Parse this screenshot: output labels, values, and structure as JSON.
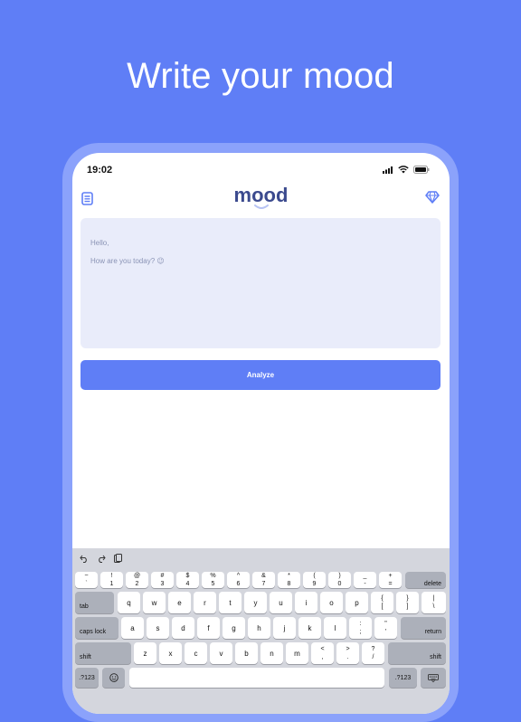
{
  "headline": "Write your mood",
  "status": {
    "time": "19:02"
  },
  "app": {
    "logo": "mood"
  },
  "editor": {
    "placeholder_line1": "Hello,",
    "placeholder_line2": "How are you today? 😉"
  },
  "actions": {
    "analyze_label": "Analyze"
  },
  "colors": {
    "background": "#5f7ef6",
    "accent": "#5f7ef6",
    "logo": "#3b4a8e",
    "editor_bg": "#e9ecfa"
  },
  "keyboard": {
    "row1": [
      {
        "top": "~",
        "bottom": "`"
      },
      {
        "top": "!",
        "bottom": "1"
      },
      {
        "top": "@",
        "bottom": "2"
      },
      {
        "top": "#",
        "bottom": "3"
      },
      {
        "top": "$",
        "bottom": "4"
      },
      {
        "top": "%",
        "bottom": "5"
      },
      {
        "top": "^",
        "bottom": "6"
      },
      {
        "top": "&",
        "bottom": "7"
      },
      {
        "top": "*",
        "bottom": "8"
      },
      {
        "top": "(",
        "bottom": "9"
      },
      {
        "top": ")",
        "bottom": "0"
      },
      {
        "top": "_",
        "bottom": "-"
      },
      {
        "top": "+",
        "bottom": "="
      }
    ],
    "delete": "delete",
    "tab": "tab",
    "row2": [
      "q",
      "w",
      "e",
      "r",
      "t",
      "y",
      "u",
      "i",
      "o",
      "p"
    ],
    "row2_extra": [
      {
        "top": "{",
        "bottom": "["
      },
      {
        "top": "}",
        "bottom": "]"
      },
      {
        "top": "|",
        "bottom": "\\"
      }
    ],
    "caps": "caps lock",
    "row3": [
      "a",
      "s",
      "d",
      "f",
      "g",
      "h",
      "j",
      "k",
      "l"
    ],
    "row3_extra": [
      {
        "top": ":",
        "bottom": ";"
      },
      {
        "top": "\"",
        "bottom": "'"
      }
    ],
    "return": "return",
    "shift_left": "shift",
    "row4": [
      "z",
      "x",
      "c",
      "v",
      "b",
      "n",
      "m"
    ],
    "row4_extra": [
      {
        "top": "<",
        "bottom": ","
      },
      {
        "top": ">",
        "bottom": "."
      },
      {
        "top": "?",
        "bottom": "/"
      }
    ],
    "shift_right": "shift",
    "numbers_left": ".?123",
    "numbers_right": ".?123"
  }
}
